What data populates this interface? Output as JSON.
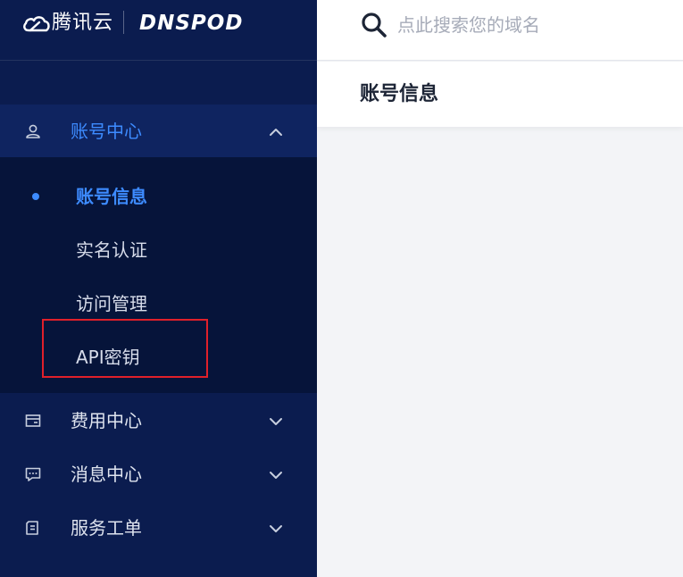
{
  "brand": {
    "tencent": "腾讯云",
    "dnspod": "DNSPOD"
  },
  "search": {
    "placeholder": "点此搜索您的域名",
    "value": ""
  },
  "page": {
    "title": "账号信息"
  },
  "sidebar": {
    "groups": [
      {
        "label": "账号中心",
        "icon": "user-icon",
        "expanded": true,
        "active": true
      },
      {
        "label": "费用中心",
        "icon": "wallet-icon",
        "expanded": false
      },
      {
        "label": "消息中心",
        "icon": "message-icon",
        "expanded": false
      },
      {
        "label": "服务工单",
        "icon": "ticket-icon",
        "expanded": false
      }
    ],
    "account_items": [
      {
        "label": "账号信息",
        "current": true
      },
      {
        "label": "实名认证"
      },
      {
        "label": "访问管理"
      },
      {
        "label": "API密钥",
        "highlighted": true
      }
    ]
  },
  "colors": {
    "sidebar_bg": "#0b1c4f",
    "submenu_bg": "#06143a",
    "accent": "#3d8bff",
    "highlight_border": "#e0202a"
  }
}
